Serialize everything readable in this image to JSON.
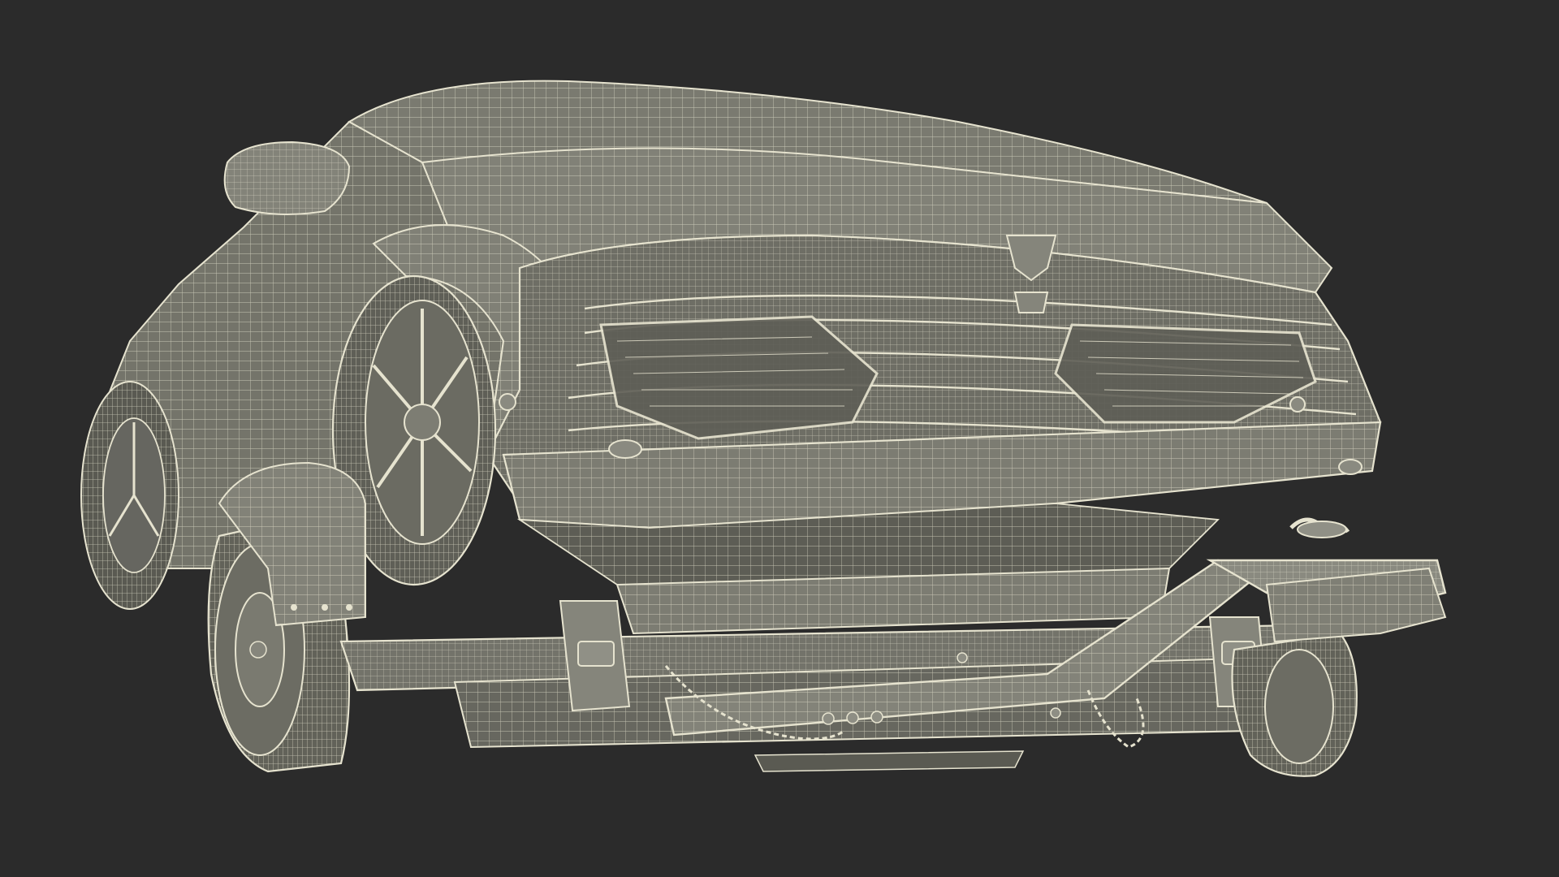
{
  "scene": {
    "subject": "wireframe-render",
    "colors": {
      "background": "#2b2b2b",
      "surface": "#7a7a70",
      "surface_dark": "#5b5b52",
      "surface_light": "#8e8e84",
      "wire": "#e6e3cf",
      "shadow": "#4a4a43"
    }
  }
}
